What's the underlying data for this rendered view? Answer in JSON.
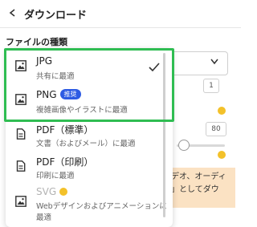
{
  "header": {
    "title": "ダウンロード"
  },
  "section": {
    "label": "ファイルの種類"
  },
  "background": {
    "value1": "1",
    "value2": "80",
    "promo_lines": [
      "デオ、オーディ",
      "」としてダウ"
    ]
  },
  "menu": {
    "items": [
      {
        "name": "JPG",
        "desc": "共有に最適",
        "selected": true
      },
      {
        "name": "PNG",
        "badge": "推奨",
        "desc": "複雑画像やイラストに最適"
      },
      {
        "name": "PDF（標準）",
        "desc": "文書（およびメール）に最適"
      },
      {
        "name": "PDF（印刷）",
        "desc": "印刷に最適"
      },
      {
        "name": "SVG",
        "desc_lines": [
          "Webデザインおよびアニメーションに",
          "最適"
        ]
      }
    ]
  },
  "colors": {
    "highlight": "#2fbd52",
    "badge": "#2d5be3",
    "crown": "#f3c12a",
    "promo_bg": "#fbe2c3"
  }
}
